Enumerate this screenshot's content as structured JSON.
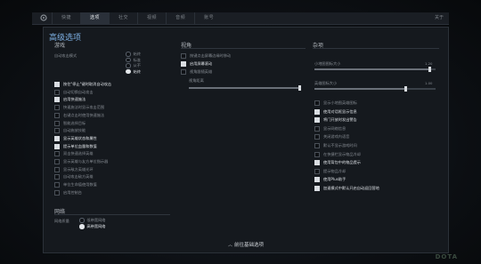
{
  "topbar": {
    "tabs": [
      "快捷",
      "选项",
      "社交",
      "视频",
      "音频",
      "账号"
    ],
    "active_index": 1,
    "close_label": "关于"
  },
  "panel": {
    "title": "高级选项",
    "basic_button": "前往基础选项",
    "basic_icon": "chevron-up-icon"
  },
  "game": {
    "title": "游戏",
    "auto_attack_label": "自动攻击模式",
    "auto_attack_options": [
      {
        "label": "始终",
        "on": false
      },
      {
        "label": "标准",
        "on": false
      },
      {
        "label": "从不",
        "on": false
      },
      {
        "label": "始终",
        "on": true
      }
    ],
    "checkboxes": [
      {
        "label": "按住\"停止\"键时取消自动攻击",
        "on": true
      },
      {
        "label": "自动切换自动攻击",
        "on": false
      },
      {
        "label": "启用快速施法",
        "on": true
      },
      {
        "label": "快速施法时显示攻击范围",
        "on": false
      },
      {
        "label": "右键点击时使用快速施法",
        "on": false
      },
      {
        "label": "智能选择目标",
        "on": false
      },
      {
        "label": "自动施放技能",
        "on": false
      },
      {
        "label": "显示英雄状态和属性",
        "on": true
      },
      {
        "label": "提示单位血量和数值",
        "on": true
      },
      {
        "label": "双击快速选择英雄",
        "on": false
      },
      {
        "label": "显示英雄与友方单位指示器",
        "on": false
      },
      {
        "label": "显示敌方英雄光环",
        "on": false
      },
      {
        "label": "自动攻击敌方英雄",
        "on": false
      },
      {
        "label": "单位生命值使用数值",
        "on": false
      },
      {
        "label": "启用控制台",
        "on": false
      }
    ]
  },
  "camera": {
    "title": "视角",
    "checkboxes": [
      {
        "label": "按键点击屏幕边缘时移动",
        "on": false
      },
      {
        "label": "启用屏幕滚动",
        "on": true
      },
      {
        "label": "视角跟随英雄",
        "on": false
      }
    ],
    "slider_label": "视角距离",
    "slider_value": 100
  },
  "misc": {
    "title": "杂项",
    "sliders": [
      {
        "label": "小地图图标大小",
        "value": "1.20",
        "fraction": 0.95
      },
      {
        "label": "英雄图标大小",
        "value": "1.00",
        "fraction": 0.75
      }
    ],
    "checkboxes": [
      {
        "label": "显示小地图英雄图标",
        "on": false
      },
      {
        "label": "使用对话框显示信息",
        "on": true
      },
      {
        "label": "将门开放时发出警告",
        "on": true
      },
      {
        "label": "显示网络信息",
        "on": false
      },
      {
        "label": "关闭游戏内语音",
        "on": false
      },
      {
        "label": "默认不显示游戏时间",
        "on": false
      },
      {
        "label": "在快捷栏显示物品冷却",
        "on": false
      },
      {
        "label": "使用背包中的物品提示",
        "on": true
      },
      {
        "label": "提示物品冷却",
        "on": false
      },
      {
        "label": "使用Plus助手",
        "on": true
      },
      {
        "label": "加速模式中默认开启自动返回营地",
        "on": true
      }
    ]
  },
  "network": {
    "title": "网络",
    "label": "网络质量",
    "options": [
      {
        "label": "低带宽网络",
        "on": false
      },
      {
        "label": "高带宽网络",
        "on": true
      }
    ]
  },
  "footer": {
    "logo_text": "DOTA"
  }
}
